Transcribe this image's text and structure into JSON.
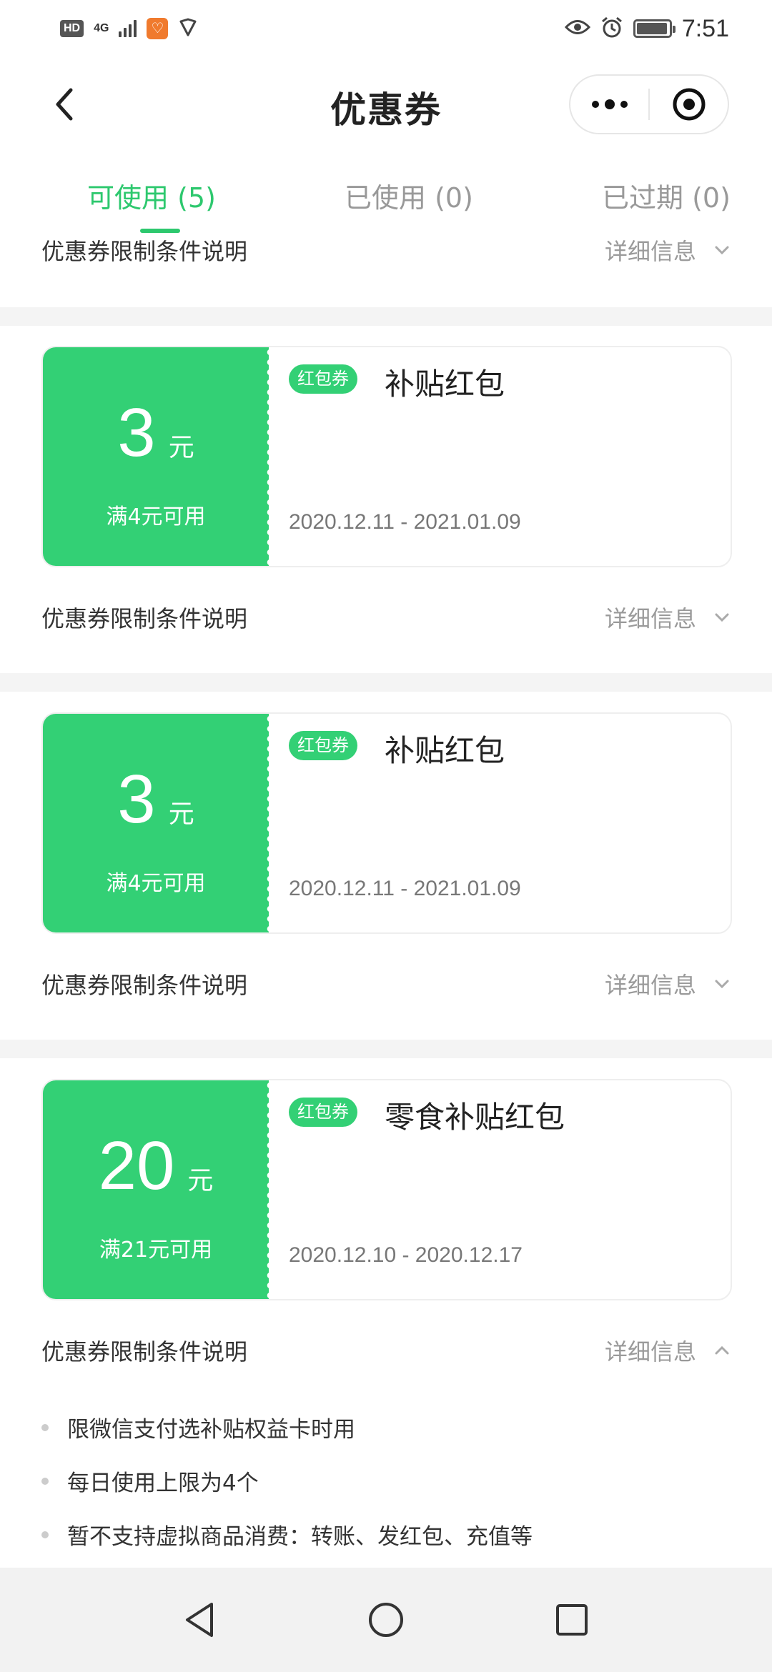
{
  "status_bar": {
    "hd_label": "HD",
    "network_label": "4G",
    "time": "7:51",
    "battery_level": 0.95
  },
  "nav": {
    "title": "优惠券"
  },
  "tabs": [
    {
      "label": "可使用 (5)",
      "active": true
    },
    {
      "label": "已使用 (0)",
      "active": false
    },
    {
      "label": "已过期 (0)",
      "active": false
    }
  ],
  "top_limit_row": {
    "label": "优惠券限制条件说明",
    "detail_label": "详细信息"
  },
  "coupons": [
    {
      "amount": "3",
      "unit": "元",
      "condition": "满4元可用",
      "type_badge": "红包券",
      "name": "补贴红包",
      "date_range": "2020.12.11 - 2021.01.09",
      "limit_label": "优惠券限制条件说明",
      "detail_label": "详细信息",
      "expanded": false
    },
    {
      "amount": "3",
      "unit": "元",
      "condition": "满4元可用",
      "type_badge": "红包券",
      "name": "补贴红包",
      "date_range": "2020.12.11 - 2021.01.09",
      "limit_label": "优惠券限制条件说明",
      "detail_label": "详细信息",
      "expanded": false
    },
    {
      "amount": "20",
      "unit": "元",
      "condition": "满21元可用",
      "type_badge": "红包券",
      "name": "零食补贴红包",
      "date_range": "2020.12.10 - 2020.12.17",
      "limit_label": "优惠券限制条件说明",
      "detail_label": "详细信息",
      "expanded": true
    }
  ],
  "rules": [
    "限微信支付选补贴权益卡时用",
    "每日使用上限为4个",
    "暂不支持虚拟商品消费：转账、发红包、充值等"
  ],
  "colors": {
    "accent": "#2dc86e",
    "coupon_green": "#33d075",
    "muted_text": "#9a9a9a",
    "section_gap": "#f4f4f4"
  }
}
